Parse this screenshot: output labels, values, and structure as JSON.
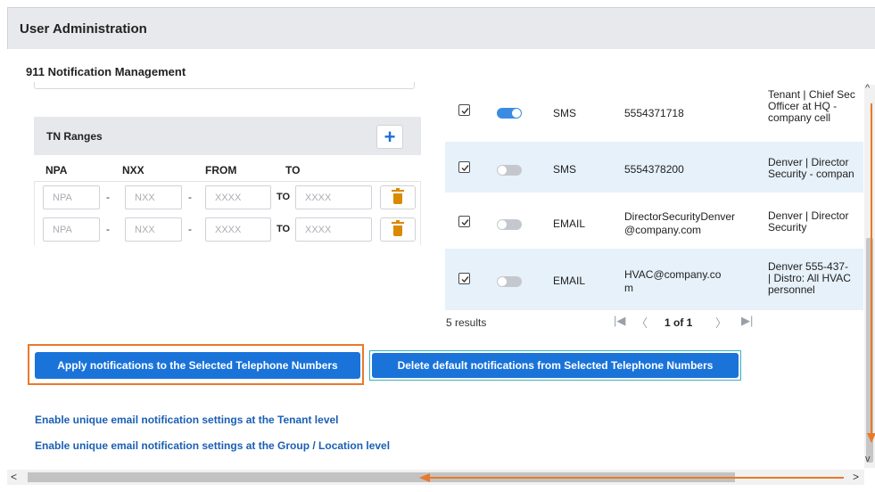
{
  "header": {
    "title": "User Administration"
  },
  "section": {
    "title": "911 Notification Management"
  },
  "tn_ranges": {
    "title": "TN Ranges",
    "add_label": "+",
    "columns": [
      "NPA",
      "NXX",
      "FROM",
      "TO"
    ],
    "separator": "-",
    "to_label": "TO",
    "placeholders": {
      "npa": "NPA",
      "nxx": "NXX",
      "from": "XXXX",
      "to": "XXXX"
    },
    "rows": [
      {
        "npa": "",
        "nxx": "",
        "from": "",
        "to": ""
      },
      {
        "npa": "",
        "nxx": "",
        "from": "",
        "to": ""
      }
    ]
  },
  "notifications": {
    "rows": [
      {
        "checked": true,
        "enabled": true,
        "type": "SMS",
        "address": "5554371718",
        "description": "Tenant | Chief Sec\nOfficer at HQ -\ncompany cell"
      },
      {
        "checked": true,
        "enabled": false,
        "type": "SMS",
        "address": "5554378200",
        "description": "Denver | Director\nSecurity - compan"
      },
      {
        "checked": true,
        "enabled": false,
        "type": "EMAIL",
        "address": "DirectorSecurityDenver@company.com",
        "description": "Denver | Director\nSecurity"
      },
      {
        "checked": true,
        "enabled": false,
        "type": "EMAIL",
        "address": "HVAC@company.com",
        "description": "Denver 555-437-\n| Distro: All HVAC\npersonnel"
      }
    ],
    "results_text": "5 results",
    "pagination": {
      "first": "|◀",
      "prev": "〈",
      "page_text": "1 of 1",
      "next": "〉",
      "last": "▶|"
    }
  },
  "actions": {
    "apply_label": "Apply notifications to the Selected Telephone Numbers",
    "delete_label": "Delete default notifications from Selected Telephone Numbers"
  },
  "links": {
    "tenant": "Enable unique email notification settings at the Tenant level",
    "group": "Enable unique email notification settings at the Group / Location level"
  },
  "scrollbars": {
    "up": "^",
    "down": "v",
    "left": "<",
    "right": ">"
  },
  "colors": {
    "primary_button": "#1a73d9",
    "toggle_on": "#3a8ce3",
    "annotation": "#e87a2c",
    "row_highlight": "#e6f1fa",
    "trash": "#d98a00"
  }
}
